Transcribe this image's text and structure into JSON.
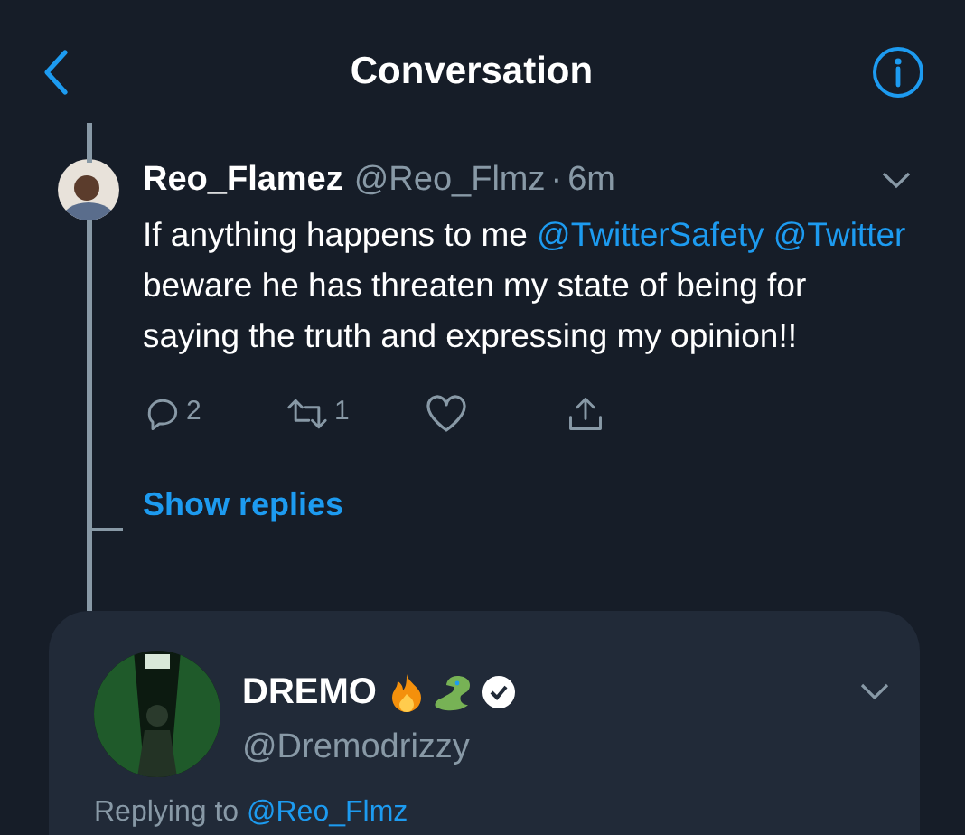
{
  "header": {
    "title": "Conversation"
  },
  "tweet": {
    "name": "Reo_Flamez",
    "handle": "@Reo_Flmz",
    "separator": "·",
    "time": "6m",
    "text": [
      {
        "kind": "plain",
        "text": "If anything happens to me "
      },
      {
        "kind": "mention",
        "text": "@TwitterSafety"
      },
      {
        "kind": "mention",
        "text": " @Twitter"
      },
      {
        "kind": "plain",
        "text": "  beware he has threaten my state of being for saying the truth and expressing my opinion!!"
      }
    ],
    "actions": [
      {
        "kind": "reply",
        "count": "2"
      },
      {
        "kind": "retweet",
        "count": "1"
      },
      {
        "kind": "like"
      },
      {
        "kind": "share"
      }
    ]
  },
  "show_replies": "Show replies",
  "reply": {
    "name": "DREMO",
    "verified": true,
    "handle": "@Dremodrizzy",
    "replying_prefix": "Replying to",
    "replying_to": "@Reo_Flmz"
  }
}
